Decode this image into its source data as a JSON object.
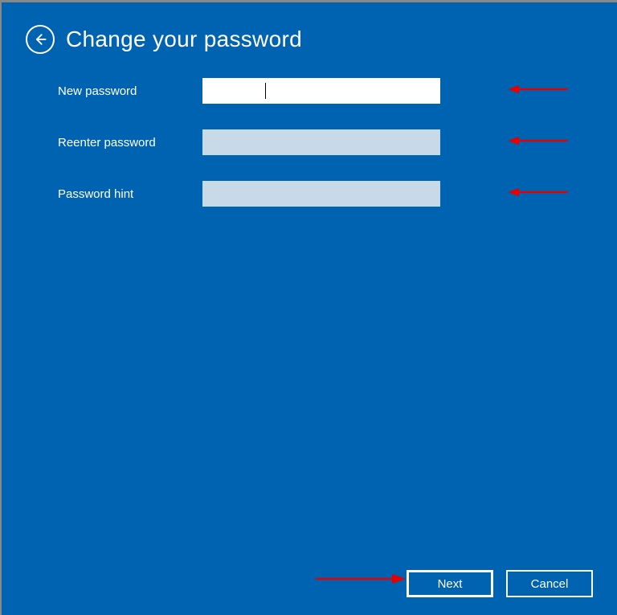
{
  "header": {
    "title": "Change your password"
  },
  "form": {
    "newPassword": {
      "label": "New password",
      "value": ""
    },
    "reenterPassword": {
      "label": "Reenter password",
      "value": ""
    },
    "passwordHint": {
      "label": "Password hint",
      "value": ""
    }
  },
  "footer": {
    "nextLabel": "Next",
    "cancelLabel": "Cancel"
  },
  "annotations": {
    "arrowColor": "#E60000"
  }
}
